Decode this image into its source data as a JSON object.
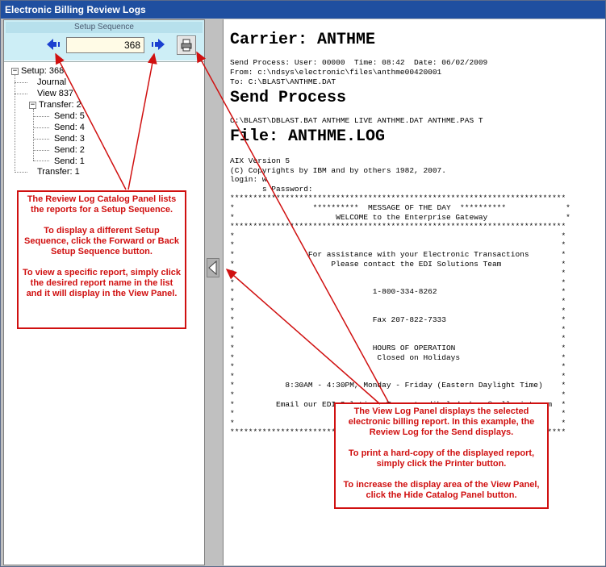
{
  "window": {
    "title": "Electronic Billing Review Logs"
  },
  "catalog": {
    "section_label": "Setup Sequence",
    "sequence_value": "368",
    "tree": {
      "setup": "Setup: 368",
      "journal": "Journal",
      "view": "View 837",
      "transfer_open": "Transfer: 2",
      "sends": [
        "Send: 5",
        "Send: 4",
        "Send: 3",
        "Send: 2",
        "Send: 1"
      ],
      "transfer_closed": "Transfer: 1"
    },
    "toggle_expanded": "−"
  },
  "view_log": {
    "carrier_heading": "Carrier: ANTHME",
    "send_info": [
      "Send Process: User: 00000  Time: 08:42  Date: 06/02/2009",
      "From: c:\\ndsys\\electronic\\files\\anthme00420001",
      "To: C:\\BLAST\\ANTHME.DAT"
    ],
    "send_heading": "Send Process",
    "command_line": "C:\\BLAST\\DBLAST.BAT ANTHME LIVE ANTHME.DAT ANTHME.PAS T",
    "file_heading": "File: ANTHME.LOG",
    "log_lines": [
      "AIX Version 5",
      "(C) Copyrights by IBM and by others 1982, 2007.",
      "login: w",
      "       s Password:",
      "*************************************************************************",
      "*                 **********  MESSAGE OF THE DAY  **********             *",
      "*                      WELCOME to the Enterprise Gateway                 *",
      "*************************************************************************",
      "*                                                                       *",
      "*                                                                       *",
      "*                For assistance with your Electronic Transactions       *",
      "*                     Please contact the EDI Solutions Team             *",
      "*                                                                       *",
      "*                                                                       *",
      "*                              1-800-334-8262                           *",
      "*                                                                       *",
      "*                                                                       *",
      "*                              Fax 207-822-7333                         *",
      "*                                                                       *",
      "*                                                                       *",
      "*                              HOURS OF OPERATION                       *",
      "*                               Closed on Holidays                      *",
      "*                                                                       *",
      "*                                                                       *",
      "*           8:30AM - 4:30PM, Monday - Friday (Eastern Daylight Time)    *",
      "*                                                                       *",
      "*         Email our EDI Solutions Team at edihelpdesk-ne@wellpoint.com  *",
      "*                                                                       *",
      "*                                                                       *",
      "*************************************************************************"
    ]
  },
  "callouts": {
    "catalog_panel": [
      "The Review Log Catalog Panel lists the reports for a Setup Sequence.",
      "To display a different Setup Sequence, click the Forward or Back Setup Sequence button.",
      "To view a specific report, simply click the desired report name in the list and it will display in the View Panel."
    ],
    "view_panel": [
      "The View Log Panel displays the selected electronic billing report.  In this example, the Review Log for the Send displays.",
      "To print a hard-copy of the displayed report, simply click the Printer button.",
      "To increase the display area of the View Panel, click the Hide Catalog Panel button."
    ]
  },
  "colors": {
    "titlebar": "#1f4fa0",
    "callout_red": "#d01010",
    "nav_arrow_blue": "#1a3fd0",
    "sequence_header": "#cdeef6"
  },
  "icons": [
    "back-arrow-icon",
    "forward-arrow-icon",
    "printer-icon",
    "hide-panel-arrow-icon"
  ]
}
